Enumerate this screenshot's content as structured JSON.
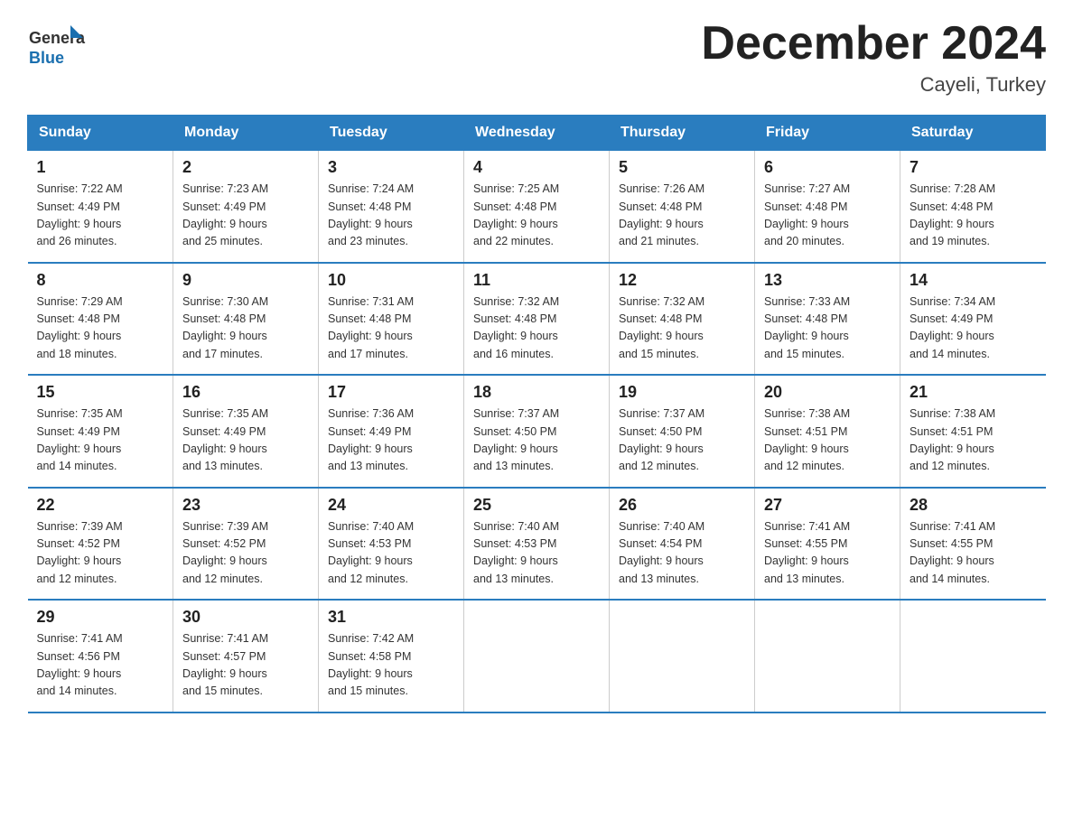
{
  "logo": {
    "text_general": "General",
    "text_blue": "Blue"
  },
  "header": {
    "month": "December 2024",
    "location": "Cayeli, Turkey"
  },
  "weekdays": [
    "Sunday",
    "Monday",
    "Tuesday",
    "Wednesday",
    "Thursday",
    "Friday",
    "Saturday"
  ],
  "weeks": [
    [
      {
        "day": "1",
        "sunrise": "Sunrise: 7:22 AM",
        "sunset": "Sunset: 4:49 PM",
        "daylight": "Daylight: 9 hours",
        "daylight2": "and 26 minutes."
      },
      {
        "day": "2",
        "sunrise": "Sunrise: 7:23 AM",
        "sunset": "Sunset: 4:49 PM",
        "daylight": "Daylight: 9 hours",
        "daylight2": "and 25 minutes."
      },
      {
        "day": "3",
        "sunrise": "Sunrise: 7:24 AM",
        "sunset": "Sunset: 4:48 PM",
        "daylight": "Daylight: 9 hours",
        "daylight2": "and 23 minutes."
      },
      {
        "day": "4",
        "sunrise": "Sunrise: 7:25 AM",
        "sunset": "Sunset: 4:48 PM",
        "daylight": "Daylight: 9 hours",
        "daylight2": "and 22 minutes."
      },
      {
        "day": "5",
        "sunrise": "Sunrise: 7:26 AM",
        "sunset": "Sunset: 4:48 PM",
        "daylight": "Daylight: 9 hours",
        "daylight2": "and 21 minutes."
      },
      {
        "day": "6",
        "sunrise": "Sunrise: 7:27 AM",
        "sunset": "Sunset: 4:48 PM",
        "daylight": "Daylight: 9 hours",
        "daylight2": "and 20 minutes."
      },
      {
        "day": "7",
        "sunrise": "Sunrise: 7:28 AM",
        "sunset": "Sunset: 4:48 PM",
        "daylight": "Daylight: 9 hours",
        "daylight2": "and 19 minutes."
      }
    ],
    [
      {
        "day": "8",
        "sunrise": "Sunrise: 7:29 AM",
        "sunset": "Sunset: 4:48 PM",
        "daylight": "Daylight: 9 hours",
        "daylight2": "and 18 minutes."
      },
      {
        "day": "9",
        "sunrise": "Sunrise: 7:30 AM",
        "sunset": "Sunset: 4:48 PM",
        "daylight": "Daylight: 9 hours",
        "daylight2": "and 17 minutes."
      },
      {
        "day": "10",
        "sunrise": "Sunrise: 7:31 AM",
        "sunset": "Sunset: 4:48 PM",
        "daylight": "Daylight: 9 hours",
        "daylight2": "and 17 minutes."
      },
      {
        "day": "11",
        "sunrise": "Sunrise: 7:32 AM",
        "sunset": "Sunset: 4:48 PM",
        "daylight": "Daylight: 9 hours",
        "daylight2": "and 16 minutes."
      },
      {
        "day": "12",
        "sunrise": "Sunrise: 7:32 AM",
        "sunset": "Sunset: 4:48 PM",
        "daylight": "Daylight: 9 hours",
        "daylight2": "and 15 minutes."
      },
      {
        "day": "13",
        "sunrise": "Sunrise: 7:33 AM",
        "sunset": "Sunset: 4:48 PM",
        "daylight": "Daylight: 9 hours",
        "daylight2": "and 15 minutes."
      },
      {
        "day": "14",
        "sunrise": "Sunrise: 7:34 AM",
        "sunset": "Sunset: 4:49 PM",
        "daylight": "Daylight: 9 hours",
        "daylight2": "and 14 minutes."
      }
    ],
    [
      {
        "day": "15",
        "sunrise": "Sunrise: 7:35 AM",
        "sunset": "Sunset: 4:49 PM",
        "daylight": "Daylight: 9 hours",
        "daylight2": "and 14 minutes."
      },
      {
        "day": "16",
        "sunrise": "Sunrise: 7:35 AM",
        "sunset": "Sunset: 4:49 PM",
        "daylight": "Daylight: 9 hours",
        "daylight2": "and 13 minutes."
      },
      {
        "day": "17",
        "sunrise": "Sunrise: 7:36 AM",
        "sunset": "Sunset: 4:49 PM",
        "daylight": "Daylight: 9 hours",
        "daylight2": "and 13 minutes."
      },
      {
        "day": "18",
        "sunrise": "Sunrise: 7:37 AM",
        "sunset": "Sunset: 4:50 PM",
        "daylight": "Daylight: 9 hours",
        "daylight2": "and 13 minutes."
      },
      {
        "day": "19",
        "sunrise": "Sunrise: 7:37 AM",
        "sunset": "Sunset: 4:50 PM",
        "daylight": "Daylight: 9 hours",
        "daylight2": "and 12 minutes."
      },
      {
        "day": "20",
        "sunrise": "Sunrise: 7:38 AM",
        "sunset": "Sunset: 4:51 PM",
        "daylight": "Daylight: 9 hours",
        "daylight2": "and 12 minutes."
      },
      {
        "day": "21",
        "sunrise": "Sunrise: 7:38 AM",
        "sunset": "Sunset: 4:51 PM",
        "daylight": "Daylight: 9 hours",
        "daylight2": "and 12 minutes."
      }
    ],
    [
      {
        "day": "22",
        "sunrise": "Sunrise: 7:39 AM",
        "sunset": "Sunset: 4:52 PM",
        "daylight": "Daylight: 9 hours",
        "daylight2": "and 12 minutes."
      },
      {
        "day": "23",
        "sunrise": "Sunrise: 7:39 AM",
        "sunset": "Sunset: 4:52 PM",
        "daylight": "Daylight: 9 hours",
        "daylight2": "and 12 minutes."
      },
      {
        "day": "24",
        "sunrise": "Sunrise: 7:40 AM",
        "sunset": "Sunset: 4:53 PM",
        "daylight": "Daylight: 9 hours",
        "daylight2": "and 12 minutes."
      },
      {
        "day": "25",
        "sunrise": "Sunrise: 7:40 AM",
        "sunset": "Sunset: 4:53 PM",
        "daylight": "Daylight: 9 hours",
        "daylight2": "and 13 minutes."
      },
      {
        "day": "26",
        "sunrise": "Sunrise: 7:40 AM",
        "sunset": "Sunset: 4:54 PM",
        "daylight": "Daylight: 9 hours",
        "daylight2": "and 13 minutes."
      },
      {
        "day": "27",
        "sunrise": "Sunrise: 7:41 AM",
        "sunset": "Sunset: 4:55 PM",
        "daylight": "Daylight: 9 hours",
        "daylight2": "and 13 minutes."
      },
      {
        "day": "28",
        "sunrise": "Sunrise: 7:41 AM",
        "sunset": "Sunset: 4:55 PM",
        "daylight": "Daylight: 9 hours",
        "daylight2": "and 14 minutes."
      }
    ],
    [
      {
        "day": "29",
        "sunrise": "Sunrise: 7:41 AM",
        "sunset": "Sunset: 4:56 PM",
        "daylight": "Daylight: 9 hours",
        "daylight2": "and 14 minutes."
      },
      {
        "day": "30",
        "sunrise": "Sunrise: 7:41 AM",
        "sunset": "Sunset: 4:57 PM",
        "daylight": "Daylight: 9 hours",
        "daylight2": "and 15 minutes."
      },
      {
        "day": "31",
        "sunrise": "Sunrise: 7:42 AM",
        "sunset": "Sunset: 4:58 PM",
        "daylight": "Daylight: 9 hours",
        "daylight2": "and 15 minutes."
      },
      {
        "day": "",
        "sunrise": "",
        "sunset": "",
        "daylight": "",
        "daylight2": ""
      },
      {
        "day": "",
        "sunrise": "",
        "sunset": "",
        "daylight": "",
        "daylight2": ""
      },
      {
        "day": "",
        "sunrise": "",
        "sunset": "",
        "daylight": "",
        "daylight2": ""
      },
      {
        "day": "",
        "sunrise": "",
        "sunset": "",
        "daylight": "",
        "daylight2": ""
      }
    ]
  ],
  "colors": {
    "header_bg": "#2a7dbf",
    "accent": "#1a6faf",
    "border": "#2a7dbf"
  }
}
